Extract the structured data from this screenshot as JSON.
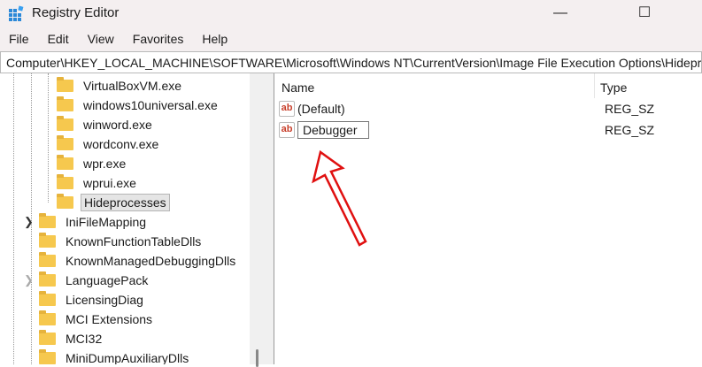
{
  "window": {
    "title": "Registry Editor",
    "minimize": "—",
    "maximize": "☐"
  },
  "menu": [
    "File",
    "Edit",
    "View",
    "Favorites",
    "Help"
  ],
  "address": "Computer\\HKEY_LOCAL_MACHINE\\SOFTWARE\\Microsoft\\Windows NT\\CurrentVersion\\Image File Execution Options\\Hideprocesses",
  "tree": {
    "children": [
      "VirtualBoxVM.exe",
      "windows10universal.exe",
      "winword.exe",
      "wordconv.exe",
      "wpr.exe",
      "wprui.exe",
      "Hideprocesses"
    ],
    "siblings": [
      "IniFileMapping",
      "KnownFunctionTableDlls",
      "KnownManagedDebuggingDlls",
      "LanguagePack",
      "LicensingDiag",
      "MCI Extensions",
      "MCI32",
      "MiniDumpAuxiliaryDlls"
    ]
  },
  "values": {
    "columns": {
      "name": "Name",
      "type": "Type"
    },
    "rows": [
      {
        "name": "(Default)",
        "type": "REG_SZ"
      },
      {
        "name": "Debugger",
        "type": "REG_SZ"
      }
    ]
  },
  "icon_text": "ab",
  "colors": {
    "annotation_arrow": "#e01010",
    "folder": "#f6c84e"
  }
}
